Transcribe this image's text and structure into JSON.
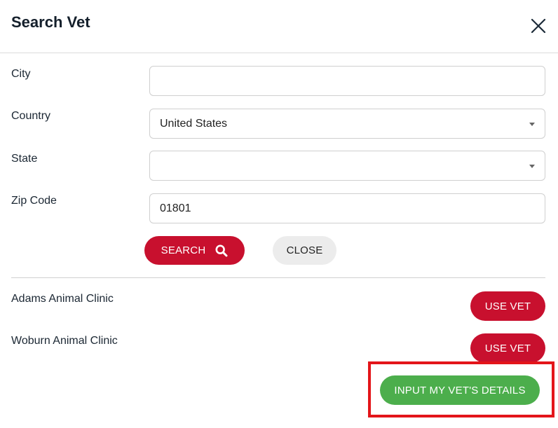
{
  "header": {
    "title": "Search Vet",
    "close_icon": "close-icon"
  },
  "form": {
    "city": {
      "label": "City",
      "value": ""
    },
    "country": {
      "label": "Country",
      "value": "United States"
    },
    "state": {
      "label": "State",
      "value": ""
    },
    "zip": {
      "label": "Zip Code",
      "value": "01801"
    }
  },
  "actions": {
    "search_label": "SEARCH",
    "search_icon": "search-icon",
    "close_label": "CLOSE"
  },
  "results": [
    {
      "name": "Adams Animal Clinic",
      "button": "USE VET"
    },
    {
      "name": "Woburn Animal Clinic",
      "button": "USE VET"
    }
  ],
  "footer": {
    "input_details_label": "INPUT MY VET'S DETAILS"
  },
  "colors": {
    "primary_red": "#c8102e",
    "green": "#4cae4c",
    "highlight": "#e3151a"
  }
}
